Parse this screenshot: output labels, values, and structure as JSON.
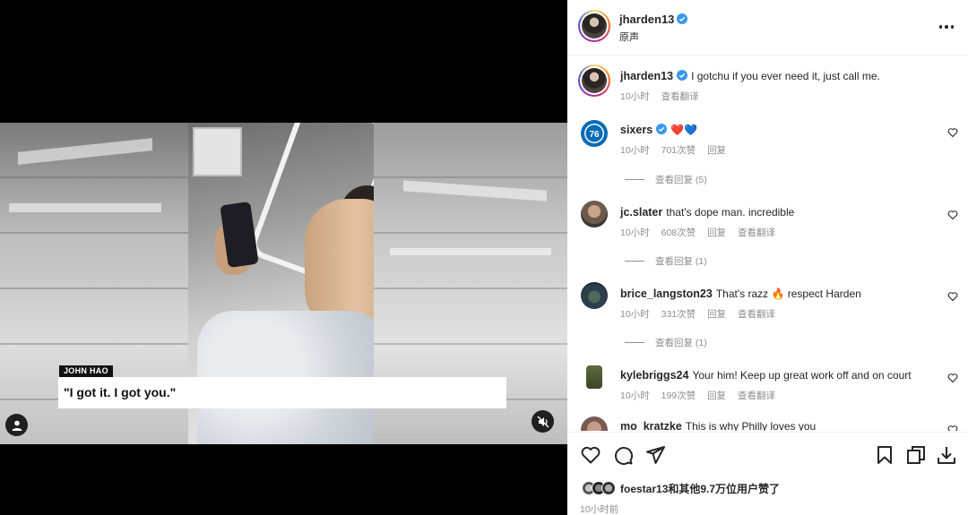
{
  "media": {
    "name_tag": "JOHN HAO",
    "caption": "\"I got it. I got you.\"",
    "icons": {
      "user_tag": "user-tag-icon",
      "mute": "speaker-muted-icon"
    }
  },
  "header": {
    "username": "jharden13",
    "subtitle": "原声",
    "more": "more-options-icon"
  },
  "comments": [
    {
      "username": "jharden13",
      "text": "I gotchu if you ever need it, just call me.",
      "time": "10小时",
      "translate": "查看翻译",
      "verified": true,
      "caption": true
    },
    {
      "username": "sixers",
      "text": "❤️💙",
      "time": "10小时",
      "likes": "701次赞",
      "reply": "回复",
      "verified": true,
      "view_replies": "查看回复 (5)"
    },
    {
      "username": "jc.slater",
      "text": "that's dope man. incredible",
      "time": "10小时",
      "likes": "608次赞",
      "reply": "回复",
      "translate": "查看翻译",
      "view_replies": "查看回复 (1)"
    },
    {
      "username": "brice_langston23",
      "text": "That's razz 🔥 respect Harden",
      "time": "10小时",
      "likes": "331次赞",
      "reply": "回复",
      "translate": "查看翻译",
      "view_replies": "查看回复 (1)"
    },
    {
      "username": "kylebriggs24",
      "text": "Your him! Keep up great work off and on court",
      "time": "10小时",
      "likes": "199次赞",
      "reply": "回复",
      "translate": "查看翻译"
    },
    {
      "username": "mo_kratzke",
      "text": "This is why Philly loves you"
    }
  ],
  "actions": {
    "icons": [
      "heart-icon",
      "comment-icon",
      "share-icon",
      "bookmark-icon",
      "copy-icon",
      "download-icon"
    ],
    "likes_text": "foestar13和其他9.7万位用户赞了",
    "time": "10小时前"
  },
  "colors": {
    "verified": "#3897f0",
    "sixers_red": "#ed174c",
    "sixers_blue": "#006bb6",
    "meta": "#8e8e8e"
  }
}
